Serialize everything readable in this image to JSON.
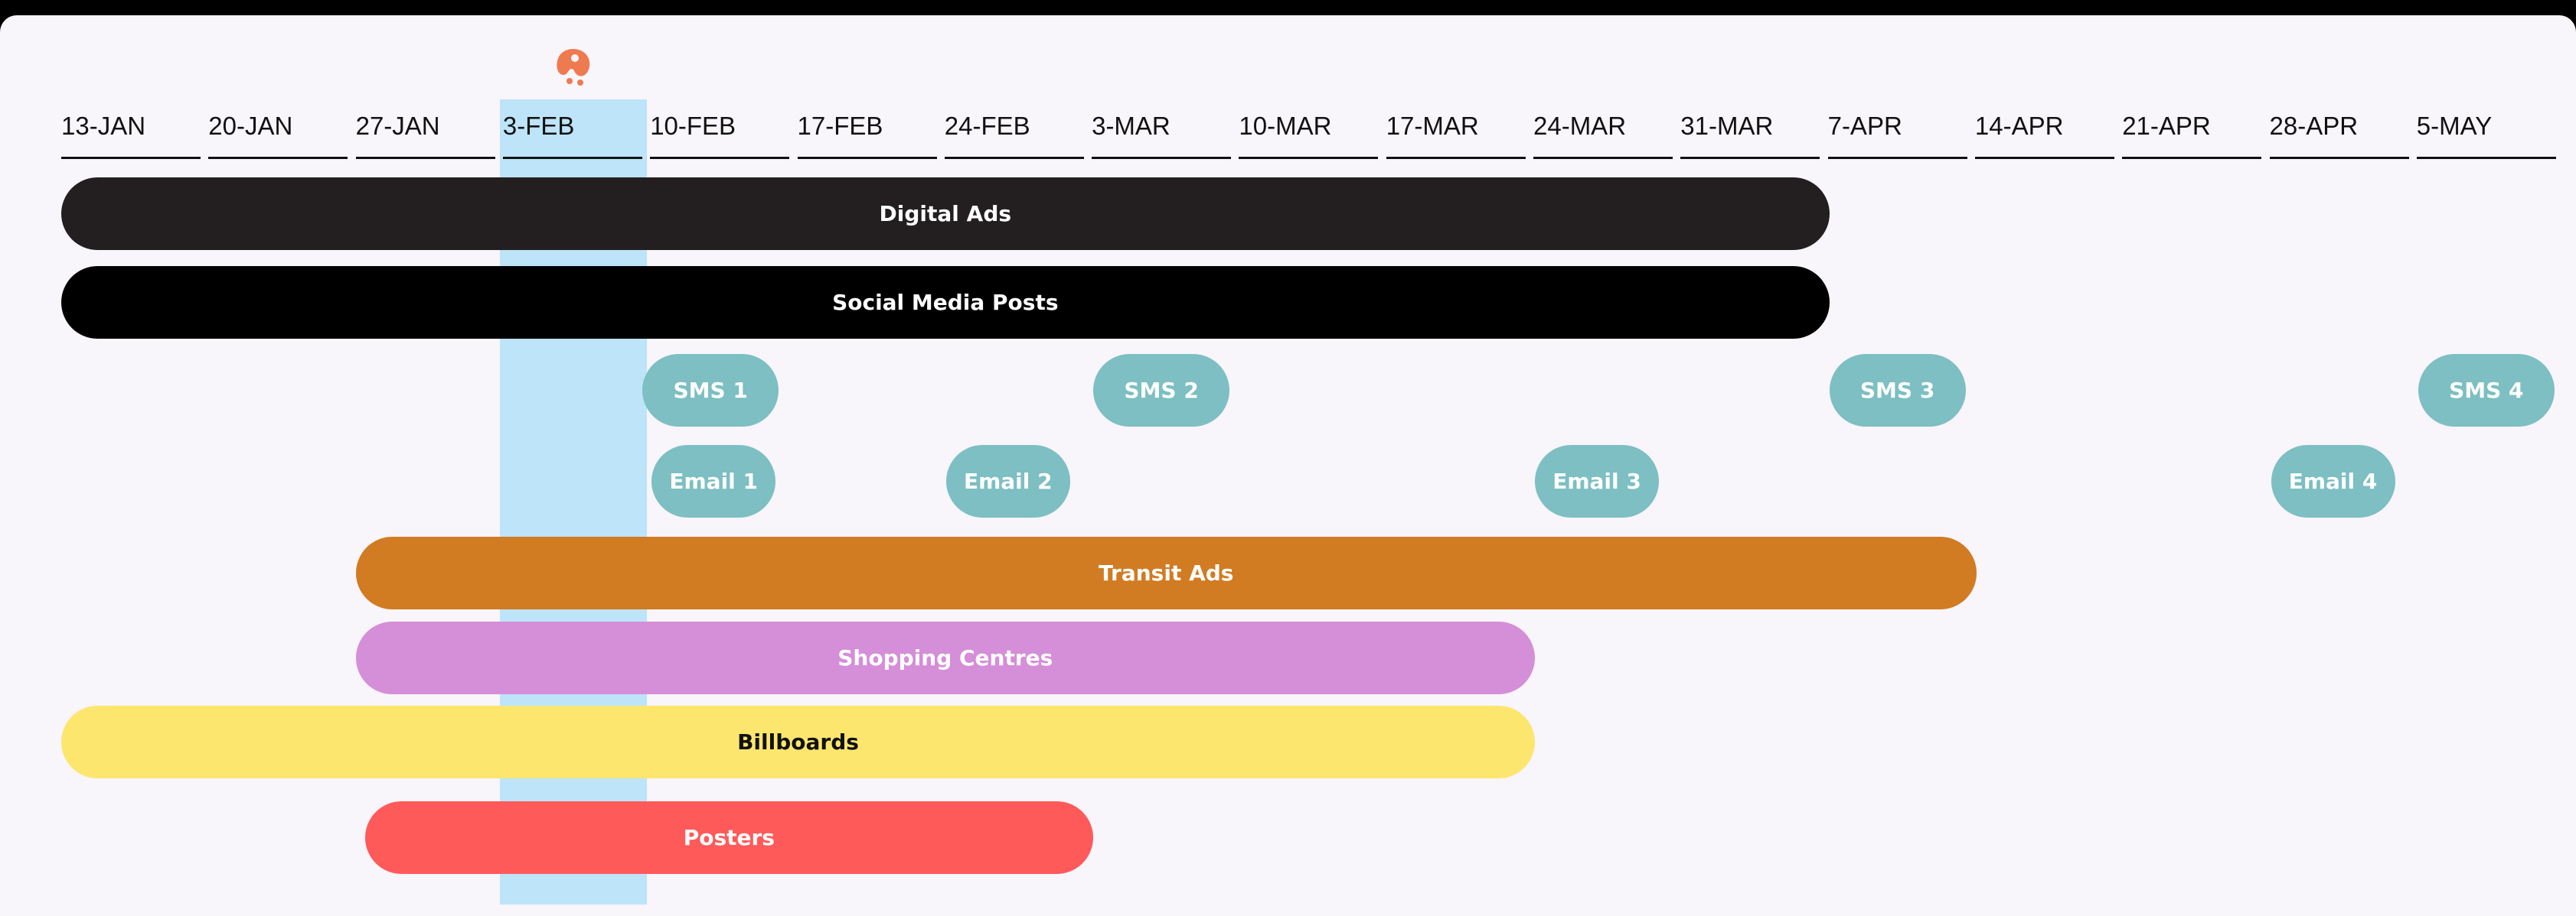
{
  "chart_data": {
    "type": "gantt",
    "categories": [
      "13-JAN",
      "20-JAN",
      "27-JAN",
      "3-FEB",
      "10-FEB",
      "17-FEB",
      "24-FEB",
      "3-MAR",
      "10-MAR",
      "17-MAR",
      "24-MAR",
      "31-MAR",
      "7-APR",
      "14-APR",
      "21-APR",
      "28-APR",
      "5-MAY"
    ],
    "highlighted_week": "3-FEB",
    "tasks": [
      {
        "label": "Digital Ads",
        "start": "13-JAN",
        "end": "31-MAR",
        "color": "#231f20",
        "text_color": "#ffffff"
      },
      {
        "label": "Social Media Posts",
        "start": "13-JAN",
        "end": "31-MAR",
        "color": "#000000",
        "text_color": "#ffffff"
      },
      {
        "label": "SMS 1",
        "start": "10-FEB",
        "end": "10-FEB",
        "color": "#7dbfc2",
        "text_color": "#ffffff"
      },
      {
        "label": "SMS 2",
        "start": "3-MAR",
        "end": "3-MAR",
        "color": "#7dbfc2",
        "text_color": "#ffffff"
      },
      {
        "label": "SMS 3",
        "start": "7-APR",
        "end": "7-APR",
        "color": "#7dbfc2",
        "text_color": "#ffffff"
      },
      {
        "label": "SMS 4",
        "start": "5-MAY",
        "end": "5-MAY",
        "color": "#7dbfc2",
        "text_color": "#ffffff"
      },
      {
        "label": "Email 1",
        "start": "10-FEB",
        "end": "10-FEB",
        "color": "#7dbfc2",
        "text_color": "#ffffff"
      },
      {
        "label": "Email 2",
        "start": "24-FEB",
        "end": "24-FEB",
        "color": "#7dbfc2",
        "text_color": "#ffffff"
      },
      {
        "label": "Email 3",
        "start": "24-MAR",
        "end": "24-MAR",
        "color": "#7dbfc2",
        "text_color": "#ffffff"
      },
      {
        "label": "Email 4",
        "start": "28-APR",
        "end": "28-APR",
        "color": "#7dbfc2",
        "text_color": "#ffffff"
      },
      {
        "label": "Transit Ads",
        "start": "27-JAN",
        "end": "7-APR",
        "color": "#d17b22",
        "text_color": "#ffffff"
      },
      {
        "label": "Shopping Centres",
        "start": "27-JAN",
        "end": "17-MAR",
        "color": "#d58ed8",
        "text_color": "#ffffff"
      },
      {
        "label": "Billboards",
        "start": "13-JAN",
        "end": "17-MAR",
        "color": "#fde66e",
        "text_color": "#111111"
      },
      {
        "label": "Posters",
        "start": "27-JAN",
        "end": "24-FEB",
        "color": "#ff5a5a",
        "text_color": "#ffffff"
      }
    ]
  }
}
